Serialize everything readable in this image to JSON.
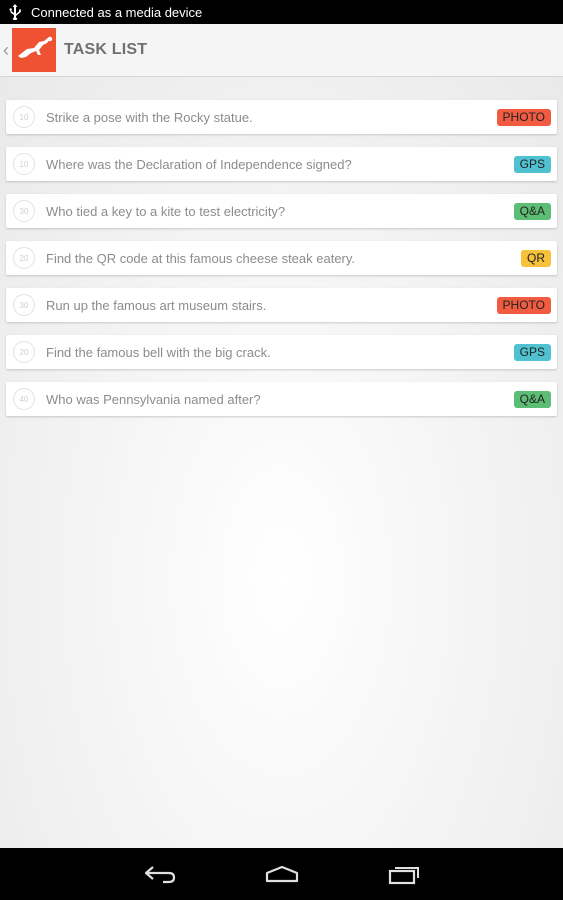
{
  "status": {
    "text": "Connected as a media device",
    "icon": "usb-icon"
  },
  "header": {
    "title": "TASK LIST",
    "logo_icon": "runner-logo-icon",
    "back_icon": "back-caret-icon"
  },
  "tasks": [
    {
      "num": "10",
      "text": "Strike a pose with the Rocky statue.",
      "type": "PHOTO",
      "color": "#f15b41"
    },
    {
      "num": "10",
      "text": "Where was the Declaration of Independence signed?",
      "type": "GPS",
      "color": "#4fc1d1"
    },
    {
      "num": "30",
      "text": "Who tied a key to a kite to test electricity?",
      "type": "Q&A",
      "color": "#5cbd74"
    },
    {
      "num": "20",
      "text": "Find the QR code at this famous cheese steak eatery.",
      "type": "QR",
      "color": "#f7c13b"
    },
    {
      "num": "30",
      "text": "Run up the famous art museum stairs.",
      "type": "PHOTO",
      "color": "#f15b41"
    },
    {
      "num": "20",
      "text": "Find the famous bell with the big crack.",
      "type": "GPS",
      "color": "#4fc1d1"
    },
    {
      "num": "40",
      "text": "Who was Pennsylvania named after?",
      "type": "Q&A",
      "color": "#5cbd74"
    }
  ],
  "nav": {
    "back_icon": "nav-back-icon",
    "home_icon": "nav-home-icon",
    "recents_icon": "nav-recents-icon"
  },
  "colors": {
    "accent": "#ee5233",
    "statusbar": "#000000",
    "actionbar": "#f5f5f5"
  }
}
